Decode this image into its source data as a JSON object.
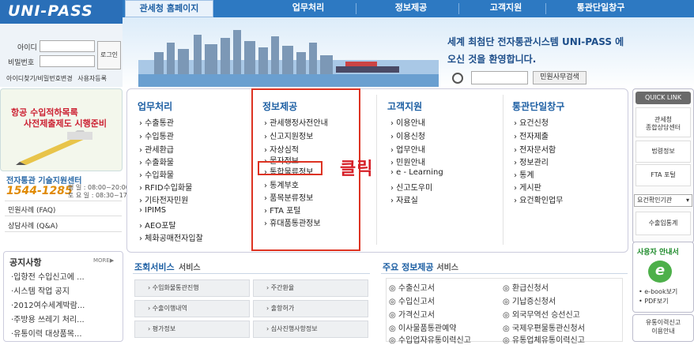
{
  "logo": "UNI-PASS",
  "nav": {
    "home": "관세청 홈페이지",
    "items": [
      "업무처리",
      "정보제공",
      "고객지원",
      "통관단일창구"
    ]
  },
  "welcome": {
    "line1": "세계 최첨단 전자통관시스템 UNI-PASS 에",
    "line2": "오신 것을 환영합니다."
  },
  "search": {
    "button": "민원사무검색",
    "placeholder": ""
  },
  "login": {
    "id_label": "아이디",
    "pw_label": "비밀번호",
    "button": "로그인",
    "find": "아이디찾기/비밀번호변경",
    "register": "사용자등록"
  },
  "promo": {
    "line1": "항공 수입적하목록",
    "line2": "사전제출제도 시행준비"
  },
  "center": {
    "title": "전자통관 기술지원센터",
    "phone": "1544-1285",
    "hours1": "평 일 : 08:00~20:00",
    "hours2": "토 요 일 : 08:30~17:30"
  },
  "side_links": [
    "민원사례 (FAQ)",
    "상담사례 (Q&A)"
  ],
  "notice": {
    "title": "공지사항",
    "more": "MORE▶",
    "items": [
      "·입항전 수입신고에 ...",
      "·시스템 작업 공지",
      "·2012여수세계박람...",
      "·주방용 쓰레기 처리...",
      "·유통이력 대상품목..."
    ]
  },
  "menu": {
    "col1": {
      "title": "업무처리",
      "items": [
        "› 수출통관",
        "› 수입통관",
        "› 관세환급",
        "› 수출화물",
        "› 수입화물",
        "› RFID수입화물",
        "› 기타전자민원",
        "› IPIMS",
        "› AEO포탈",
        "› 체화공매전자입찰"
      ]
    },
    "col2": {
      "title": "정보제공",
      "items": [
        "› 관세행정사전안내",
        "› 신고지원정보",
        "› 자상심적",
        "› 물자정보",
        "› 통합물류정보",
        "› 통계부호",
        "› 품목분류정보",
        "› FTA 포털",
        "› 휴대품통관정보"
      ]
    },
    "col3": {
      "title": "고객지원",
      "items": [
        "› 이용안내",
        "› 이용신청",
        "› 업무안내",
        "› 민원안내",
        "› e - Learning",
        "› 신고도우미",
        "› 자료실"
      ]
    },
    "col4": {
      "title": "통관단일창구",
      "items": [
        "› 요건신청",
        "› 전자제출",
        "› 전자문서함",
        "› 정보관리",
        "› 통계",
        "› 게시판",
        "› 요건확인업무"
      ]
    }
  },
  "annotation": "클릭",
  "services": {
    "title": "조회서비스",
    "suffix": "서비스",
    "buttons": [
      "› 수입화물통관진행",
      "› 주간환율",
      "› 수출이행내역",
      "› 출항허가",
      "› 평가정보",
      "› 심사진행사항정보"
    ]
  },
  "info": {
    "title": "주요 정보제공",
    "suffix": "서비스",
    "col1": [
      "수출신고서",
      "수입신고서",
      "가격신고서",
      "이사물품통관예약",
      "수입업자유통이력신고"
    ],
    "col2": [
      "환급신청서",
      "기납증신청서",
      "외국무역선 승선신고",
      "국제우편물통관신청서",
      "유통업체유통이력신고"
    ]
  },
  "quick": {
    "title": "QUICK LINK",
    "items": [
      "관세청\n종합상담센터",
      "법령정보",
      "FTA 포털"
    ],
    "select": "요건확인기관",
    "last": "수출입통계"
  },
  "user_guide": {
    "title": "사용자 안내서",
    "icon": "e",
    "links": [
      "• e-book보기",
      "• PDF보기"
    ]
  },
  "bottom_right": "유통이력신고\n이용안내"
}
